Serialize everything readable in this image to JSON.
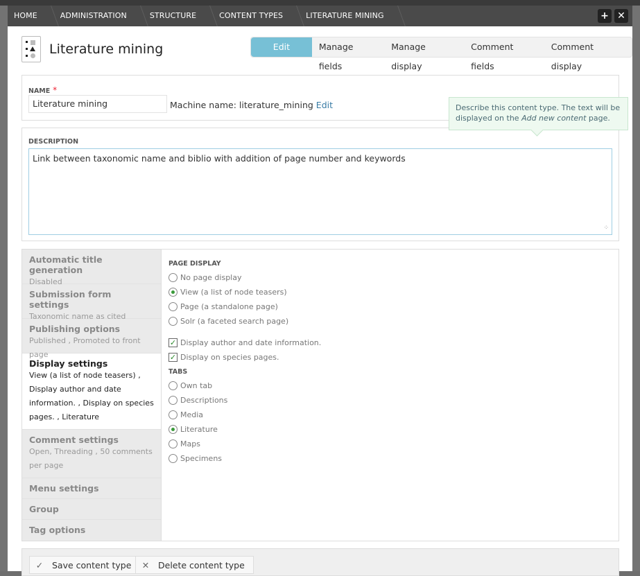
{
  "breadcrumb": [
    "HOME",
    "ADMINISTRATION",
    "STRUCTURE",
    "CONTENT TYPES",
    "LITERATURE MINING"
  ],
  "overlay_actions": {
    "add": "+",
    "close": "✕"
  },
  "page_title": "Literature mining",
  "tabs": [
    "Edit",
    "Manage fields",
    "Manage display",
    "Comment fields",
    "Comment display"
  ],
  "name_section": {
    "label": "NAME",
    "required_mark": "*",
    "value": "Literature mining",
    "machine_prefix": "Machine name: literature_mining",
    "machine_edit": "Edit"
  },
  "tooltip": {
    "pre": "Describe this content type. The text will be displayed on the ",
    "emph": "Add new content",
    "post": " page."
  },
  "description": {
    "label": "DESCRIPTION",
    "value": "Link between taxonomic name and biblio with addition of page number and keywords"
  },
  "vertical_tabs": [
    {
      "title": "Automatic title generation",
      "summary": "Disabled"
    },
    {
      "title": "Submission form settings",
      "summary": "Taxonomic name as cited"
    },
    {
      "title": "Publishing options",
      "summary": "Published , Promoted to front page"
    },
    {
      "title": "Display settings",
      "summary": "View (a list of node teasers) , Display author and date information. , Display on species pages. , Literature"
    },
    {
      "title": "Comment settings",
      "summary": "Open, Threading , 50 comments per page"
    },
    {
      "title": "Menu settings",
      "summary": ""
    },
    {
      "title": "Group",
      "summary": ""
    },
    {
      "title": "Tag options",
      "summary": ""
    }
  ],
  "display_pane": {
    "page_display_label": "PAGE DISPLAY",
    "page_display_options": [
      "No page display",
      "View (a list of node teasers)",
      "Page (a standalone page)",
      "Solr (a faceted search page)"
    ],
    "page_display_selected": 1,
    "checkboxes": [
      "Display author and date information.",
      "Display on species pages."
    ],
    "tabs_label": "TABS",
    "tab_options": [
      "Own tab",
      "Descriptions",
      "Media",
      "Literature",
      "Maps",
      "Specimens"
    ],
    "tab_selected": 3
  },
  "footer": {
    "save": "Save content type",
    "delete": "Delete content type",
    "save_icon": "✓",
    "delete_icon": "✕"
  },
  "colors": {
    "accent": "#77c0d6",
    "bar": "#4a4a4a",
    "tooltip_bg": "#eef9f0"
  }
}
